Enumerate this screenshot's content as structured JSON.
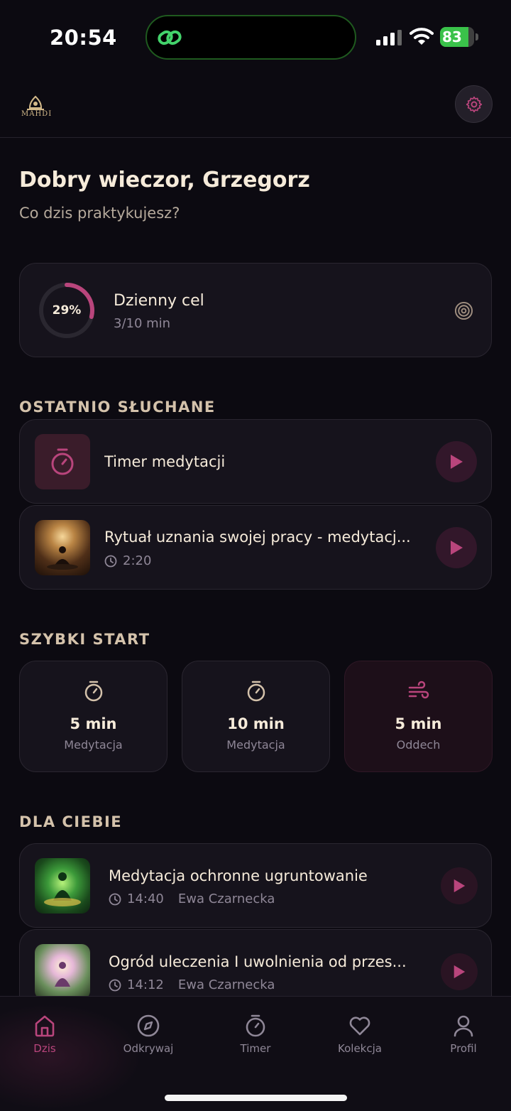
{
  "status_bar": {
    "time": "20:54",
    "battery_percent": "83"
  },
  "header": {
    "logo_text": "MAHDI",
    "settings_icon": "gear-icon"
  },
  "greeting": {
    "title": "Dobry wieczor, Grzegorz",
    "subtitle": "Co dzis praktykujesz?"
  },
  "goal": {
    "percent_label": "29%",
    "progress": 0.29,
    "title": "Dzienny cel",
    "subtitle": "3/10 min"
  },
  "recent": {
    "section_title": "OSTATNIO SŁUCHANE",
    "items": [
      {
        "title": "Timer medytacji"
      },
      {
        "title": "Rytuał uznania swojej pracy - medytacj...",
        "duration": "2:20"
      }
    ]
  },
  "quick_start": {
    "section_title": "SZYBKI START",
    "items": [
      {
        "value": "5 min",
        "label": "Medytacja",
        "icon": "timer-icon"
      },
      {
        "value": "10 min",
        "label": "Medytacja",
        "icon": "timer-icon"
      },
      {
        "value": "5 min",
        "label": "Oddech",
        "icon": "wind-icon"
      }
    ]
  },
  "for_you": {
    "section_title": "DLA CIEBIE",
    "items": [
      {
        "title": "Medytacja ochronne ugruntowanie",
        "duration": "14:40",
        "author": "Ewa Czarnecka"
      },
      {
        "title": "Ogród uleczenia I uwolnienia od przes...",
        "duration": "14:12",
        "author": "Ewa Czarnecka"
      }
    ]
  },
  "nav": {
    "items": [
      {
        "label": "Dzis",
        "icon": "home-icon",
        "active": true
      },
      {
        "label": "Odkrywaj",
        "icon": "compass-icon",
        "active": false
      },
      {
        "label": "Timer",
        "icon": "timer-icon",
        "active": false
      },
      {
        "label": "Kolekcja",
        "icon": "heart-icon",
        "active": false
      },
      {
        "label": "Profil",
        "icon": "user-icon",
        "active": false
      }
    ]
  },
  "colors": {
    "accent": "#b9457c",
    "background": "#0c0a11",
    "card": "#16131c"
  }
}
